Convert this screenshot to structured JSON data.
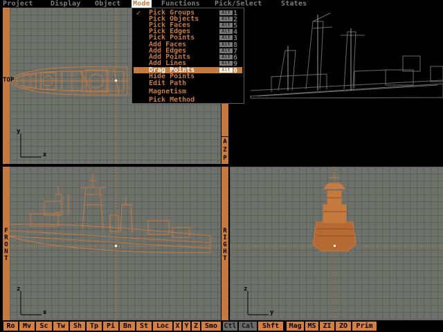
{
  "menubar": {
    "items": [
      {
        "label": "Project",
        "active": false
      },
      {
        "label": "Display",
        "active": false
      },
      {
        "label": "Object",
        "active": false
      },
      {
        "label": "Mode",
        "active": true
      },
      {
        "label": "Functions",
        "active": false
      },
      {
        "label": "Pick/Select",
        "active": false
      },
      {
        "label": "States",
        "active": false
      }
    ]
  },
  "mode_menu": {
    "items": [
      {
        "label": "Pick Groups",
        "key": "1",
        "checked": true,
        "highlight": false
      },
      {
        "label": "Pick Objects",
        "key": "2",
        "checked": false,
        "highlight": false
      },
      {
        "label": "Pick Faces",
        "key": "5",
        "checked": false,
        "highlight": false
      },
      {
        "label": "Pick Edges",
        "key": "4",
        "checked": false,
        "highlight": false
      },
      {
        "label": "Pick Points",
        "key": "3",
        "checked": false,
        "highlight": false
      },
      {
        "label": "Add Faces",
        "key": "8",
        "checked": false,
        "highlight": false
      },
      {
        "label": "Add Edges",
        "key": "7",
        "checked": false,
        "highlight": false
      },
      {
        "label": "Add Points",
        "key": "6",
        "checked": false,
        "highlight": false
      },
      {
        "label": "Add Lines",
        "key": "9",
        "checked": false,
        "highlight": false
      },
      {
        "label": "Drag Points",
        "key": "0",
        "checked": false,
        "highlight": true
      },
      {
        "label": "Hide Points",
        "key": "",
        "checked": false,
        "highlight": false
      },
      {
        "label": "Edit Path",
        "key": "",
        "checked": false,
        "highlight": false
      },
      {
        "label": "Magnetism",
        "key": "",
        "checked": false,
        "highlight": false
      },
      {
        "label": "Pick Method",
        "key": "",
        "checked": false,
        "highlight": false
      }
    ],
    "shortcut_prefix": "Alt"
  },
  "views": {
    "top": {
      "label": "TOP",
      "axis_v": "y",
      "axis_h": "x"
    },
    "front": {
      "label": "FRONT",
      "axis_v": "z",
      "axis_h": "x"
    },
    "right": {
      "label": "RIGHT",
      "axis_v": "z",
      "axis_h": "y"
    },
    "perspective": {
      "label": "AZP"
    }
  },
  "toolbar": {
    "buttons": [
      {
        "label": "Ro",
        "muted": false
      },
      {
        "label": "Mv",
        "muted": false
      },
      {
        "label": "Sc",
        "muted": false
      },
      {
        "label": "Tw",
        "muted": false
      },
      {
        "label": "Sh",
        "muted": false
      },
      {
        "label": "Tp",
        "muted": false
      },
      {
        "label": "Pi",
        "muted": false
      },
      {
        "label": "Bn",
        "muted": false
      },
      {
        "label": "St",
        "muted": false
      },
      {
        "label": "Loc",
        "muted": false
      },
      {
        "label": "X",
        "muted": false
      },
      {
        "label": "Y",
        "muted": false
      },
      {
        "label": "Z",
        "muted": false
      },
      {
        "label": "Smo",
        "muted": false
      },
      {
        "label": "Ctl",
        "muted": true
      },
      {
        "label": "Cal",
        "muted": true
      },
      {
        "label": "Shft",
        "muted": false
      },
      {
        "label": "Mag",
        "muted": false
      },
      {
        "label": "MS",
        "muted": false
      },
      {
        "label": "ZI",
        "muted": false
      },
      {
        "label": "ZO",
        "muted": false
      },
      {
        "label": "Prim",
        "muted": false
      }
    ]
  },
  "colors": {
    "accent": "#c57a3f",
    "wire": "#c97a3e",
    "grid_bg": "#6f716b",
    "menu_text": "#7d7d7d"
  }
}
